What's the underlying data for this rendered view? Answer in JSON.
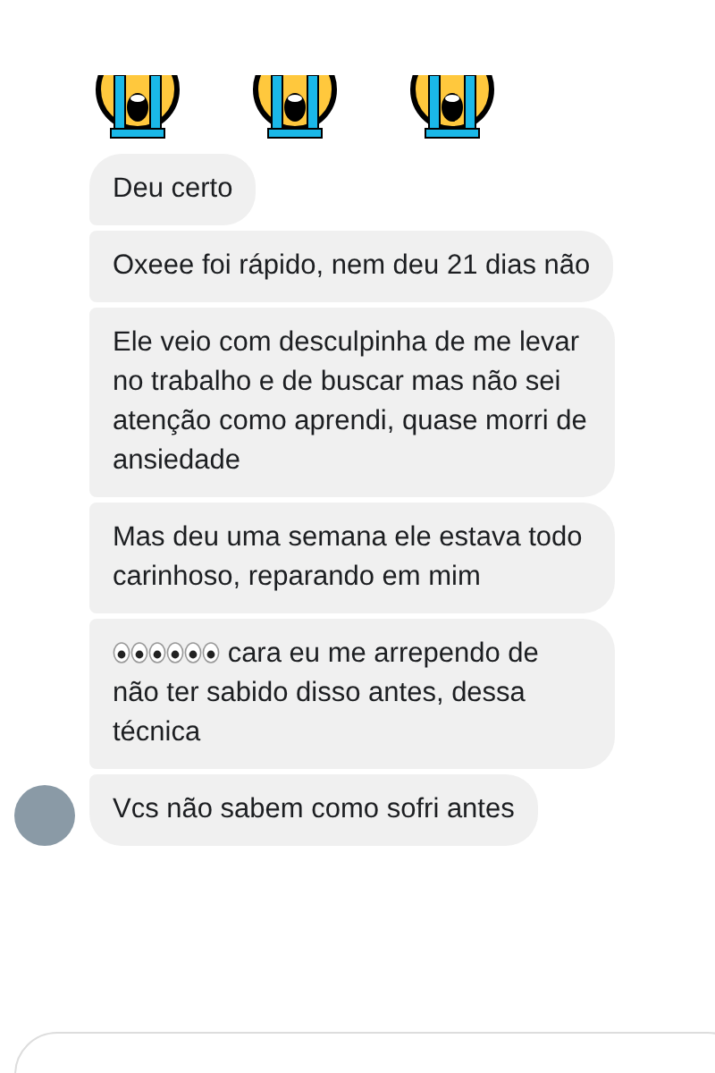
{
  "messages": [
    {
      "kind": "text",
      "text": "Deu certo"
    },
    {
      "kind": "text",
      "text": "Oxeee foi rápido, nem deu 21 dias não"
    },
    {
      "kind": "text",
      "text": "Ele veio com desculpinha de me levar no trabalho e de buscar mas não sei atenção como aprendi, quase morri de ansiedade"
    },
    {
      "kind": "text",
      "text": "Mas deu uma semana ele estava todo carinhoso, reparando em mim"
    },
    {
      "kind": "eyes_text",
      "text": "cara eu me arrependo de não ter sabido disso antes, dessa técnica"
    },
    {
      "kind": "text",
      "text": "Vcs não sabem como sofri antes"
    }
  ]
}
